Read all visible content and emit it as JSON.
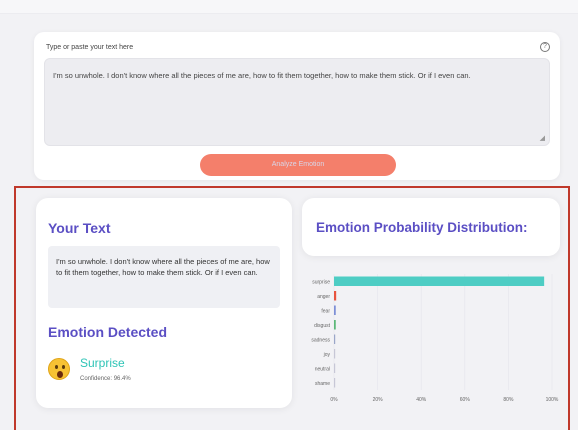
{
  "input": {
    "label": "Type or paste your text here",
    "help_icon": "?",
    "value": "I'm so unwhole. I don't know where all the pieces of me are, how to fit them together, how to make them stick. Or if I even can.",
    "resize_glyph": "◢",
    "analyze_button": "Analyze Emotion"
  },
  "your_text": {
    "title": "Your Text",
    "text": "I'm so unwhole. I don't know where all the pieces of me are, how to fit them together, how to make them stick. Or if I even can."
  },
  "emotion_detected": {
    "title": "Emotion Detected",
    "emotion": "Surprise",
    "confidence": "Confidence: 96.4%",
    "icon": "surprised-face-icon"
  },
  "chart": {
    "title": "Emotion Probability Distribution:"
  },
  "colors": {
    "accent": "#5b4fc4",
    "button": "#f47f6b",
    "surprise": "#4ecdc4",
    "highlight_frame": "#c0392b"
  },
  "chart_data": {
    "type": "bar",
    "orientation": "horizontal",
    "categories": [
      "surprise",
      "anger",
      "fear",
      "disgust",
      "sadness",
      "joy",
      "neutral",
      "shame"
    ],
    "values": [
      0.964,
      0.01,
      0.008,
      0.008,
      0.005,
      0.002,
      0.002,
      0.001
    ],
    "colors": [
      "#4ecdc4",
      "#e8543f",
      "#7d8fd6",
      "#5cb878",
      "#9aa6c8",
      "#c7c7d6",
      "#c7c7d6",
      "#c7c7d6"
    ],
    "xlim": [
      0,
      1
    ],
    "xticks": [
      "0%",
      "20%",
      "40%",
      "60%",
      "80%",
      "100%"
    ],
    "grid": true
  }
}
